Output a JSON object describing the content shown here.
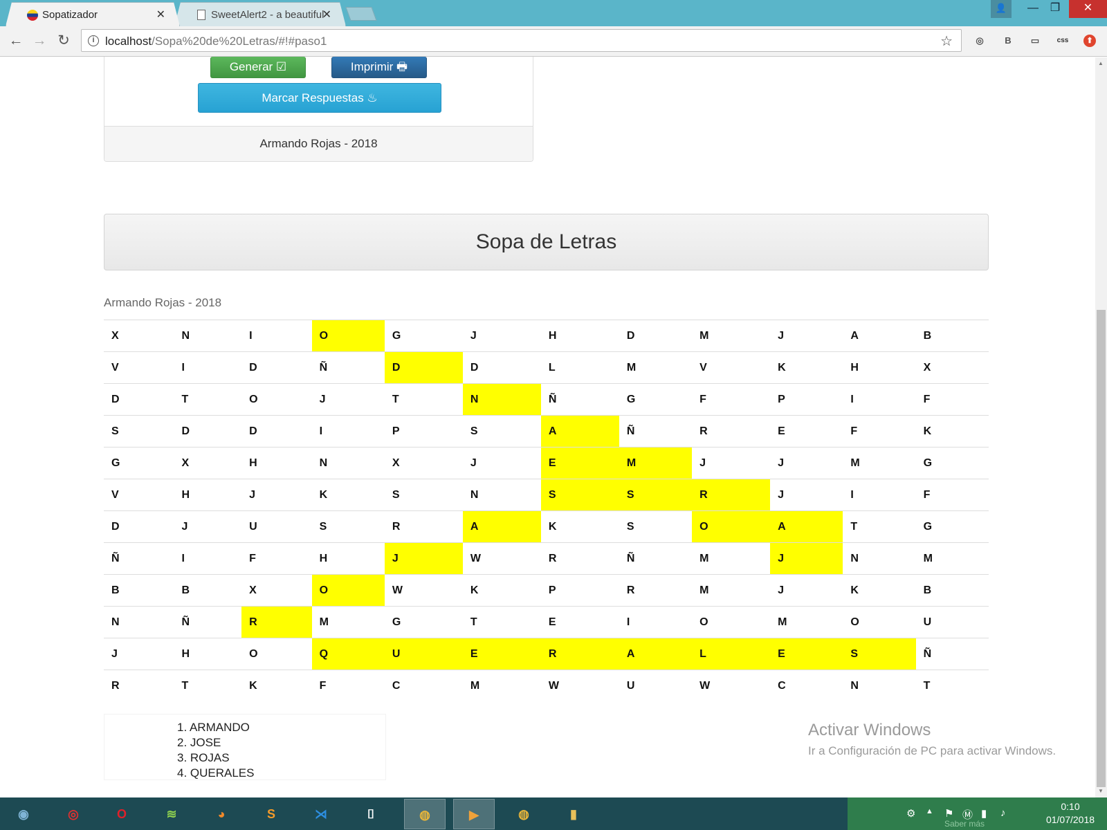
{
  "browser": {
    "tabs": [
      {
        "title": "Sopatizador",
        "close": "✕"
      },
      {
        "title": "SweetAlert2 - a beautiful",
        "close": "✕"
      }
    ],
    "url_host": "localhost",
    "url_path": "/Sopa%20de%20Letras/#!#paso1",
    "nav": {
      "back": "←",
      "forward": "→",
      "reload": "↻"
    },
    "star": "☆",
    "window": {
      "minimize": "—",
      "maximize": "❐",
      "close": "✕",
      "user": "👤"
    },
    "extensions": [
      {
        "icon": "globe-icon",
        "glyph": "◎"
      },
      {
        "icon": "b-icon",
        "glyph": "B"
      },
      {
        "icon": "cast-icon",
        "glyph": "▭"
      },
      {
        "icon": "css-icon",
        "glyph": "css"
      },
      {
        "icon": "upload-icon",
        "glyph": "⬆"
      }
    ]
  },
  "panel": {
    "generate_label": "Generar ☑",
    "print_label": "Imprimir 🖶",
    "mark_label": "Marcar Respuestas ♨",
    "footer": "Armando Rojas - 2018"
  },
  "main": {
    "title": "Sopa de Letras",
    "credit": "Armando Rojas - 2018",
    "grid": [
      [
        "X",
        "N",
        "I",
        "O",
        "G",
        "J",
        "H",
        "D",
        "M",
        "J",
        "A",
        "B"
      ],
      [
        "V",
        "I",
        "D",
        "Ñ",
        "D",
        "D",
        "L",
        "M",
        "V",
        "K",
        "H",
        "X"
      ],
      [
        "D",
        "T",
        "O",
        "J",
        "T",
        "N",
        "Ñ",
        "G",
        "F",
        "P",
        "I",
        "F"
      ],
      [
        "S",
        "D",
        "D",
        "I",
        "P",
        "S",
        "A",
        "Ñ",
        "R",
        "E",
        "F",
        "K"
      ],
      [
        "G",
        "X",
        "H",
        "N",
        "X",
        "J",
        "E",
        "M",
        "J",
        "J",
        "M",
        "G"
      ],
      [
        "V",
        "H",
        "J",
        "K",
        "S",
        "N",
        "S",
        "S",
        "R",
        "J",
        "I",
        "F"
      ],
      [
        "D",
        "J",
        "U",
        "S",
        "R",
        "A",
        "K",
        "S",
        "O",
        "A",
        "T",
        "G"
      ],
      [
        "Ñ",
        "I",
        "F",
        "H",
        "J",
        "W",
        "R",
        "Ñ",
        "M",
        "J",
        "N",
        "M"
      ],
      [
        "B",
        "B",
        "X",
        "O",
        "W",
        "K",
        "P",
        "R",
        "M",
        "J",
        "K",
        "B"
      ],
      [
        "N",
        "Ñ",
        "R",
        "M",
        "G",
        "T",
        "E",
        "I",
        "O",
        "M",
        "O",
        "U"
      ],
      [
        "J",
        "H",
        "O",
        "Q",
        "U",
        "E",
        "R",
        "A",
        "L",
        "E",
        "S",
        "Ñ"
      ],
      [
        "R",
        "T",
        "K",
        "F",
        "C",
        "M",
        "W",
        "U",
        "W",
        "C",
        "N",
        "T"
      ]
    ],
    "highlighted": [
      [
        0,
        3
      ],
      [
        1,
        4
      ],
      [
        2,
        5
      ],
      [
        3,
        6
      ],
      [
        4,
        6
      ],
      [
        4,
        7
      ],
      [
        5,
        6
      ],
      [
        5,
        7
      ],
      [
        5,
        8
      ],
      [
        6,
        5
      ],
      [
        6,
        8
      ],
      [
        6,
        9
      ],
      [
        7,
        4
      ],
      [
        7,
        9
      ],
      [
        8,
        3
      ],
      [
        9,
        2
      ],
      [
        10,
        3
      ],
      [
        10,
        4
      ],
      [
        10,
        5
      ],
      [
        10,
        6
      ],
      [
        10,
        7
      ],
      [
        10,
        8
      ],
      [
        10,
        9
      ],
      [
        10,
        10
      ]
    ],
    "highlight_color": "#ffff00",
    "words": [
      "1. ARMANDO",
      "2. JOSE",
      "3. ROJAS",
      "4. QUERALES"
    ]
  },
  "watermark": {
    "line1": "Activar Windows",
    "line2": "Ir a Configuración de PC para activar Windows."
  },
  "taskbar": {
    "apps": [
      {
        "name": "start-icon",
        "glyph": "◉",
        "color": "#7fb4d6"
      },
      {
        "name": "media-player-icon",
        "glyph": "◎",
        "color": "#e03030"
      },
      {
        "name": "opera-icon",
        "glyph": "O",
        "color": "#e0202a"
      },
      {
        "name": "wifi-app-icon",
        "glyph": "≋",
        "color": "#8fd14f"
      },
      {
        "name": "firefox-icon",
        "glyph": "◕",
        "color": "#f0892a"
      },
      {
        "name": "sublime-icon",
        "glyph": "S",
        "color": "#f49b2a"
      },
      {
        "name": "vscode-icon",
        "glyph": "⋊",
        "color": "#2d8ee0"
      },
      {
        "name": "terminal-icon",
        "glyph": "⌷",
        "color": "#ffffff"
      },
      {
        "name": "chrome-icon",
        "glyph": "◍",
        "color": "#e8b53a"
      },
      {
        "name": "video-icon",
        "glyph": "▶",
        "color": "#f0a23a"
      },
      {
        "name": "chrome-icon-2",
        "glyph": "◍",
        "color": "#e8b53a"
      },
      {
        "name": "folder-icon",
        "glyph": "▮",
        "color": "#e8c05a"
      }
    ],
    "clock_time": "0:10",
    "clock_date": "01/07/2018",
    "tray_hint": "Saber más"
  }
}
